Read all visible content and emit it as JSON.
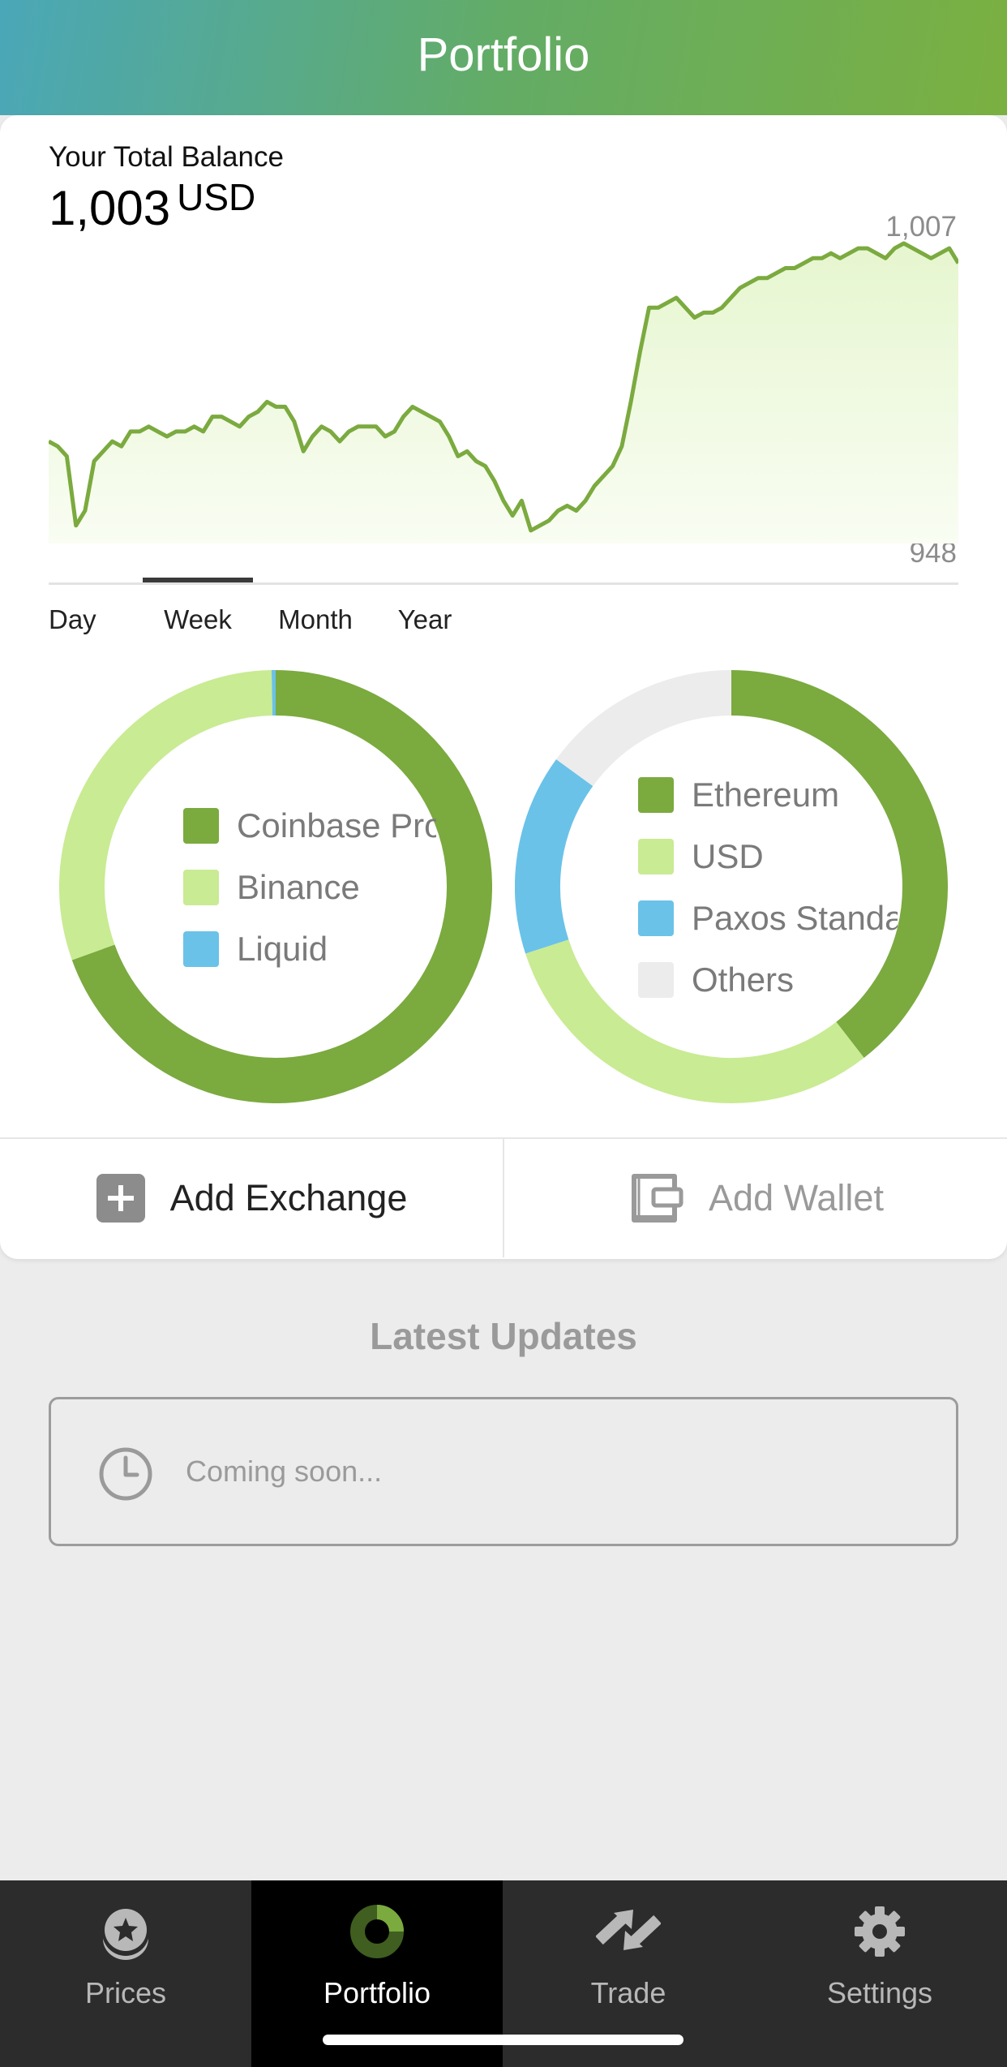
{
  "header": {
    "title": "Portfolio"
  },
  "balance": {
    "label": "Your Total Balance",
    "value": "1,003",
    "currency": "USD"
  },
  "colors": {
    "brand_green": "#7baa3f",
    "light_green": "#c9eb93",
    "blue": "#6ac2e8",
    "others_gray": "#ececec"
  },
  "balance_tabs": [
    {
      "label": "Day",
      "active": false
    },
    {
      "label": "Week",
      "active": true
    },
    {
      "label": "Month",
      "active": false
    },
    {
      "label": "Year",
      "active": false
    }
  ],
  "chart_data": [
    {
      "type": "area",
      "y_max_label": "1,007",
      "y_min_label": "948",
      "ylim": [
        948,
        1007
      ],
      "x": [
        0,
        1,
        2,
        3,
        4,
        5,
        6,
        7,
        8,
        9,
        10,
        11,
        12,
        13,
        14,
        15,
        16,
        17,
        18,
        19,
        20,
        21,
        22,
        23,
        24,
        25,
        26,
        27,
        28,
        29,
        30,
        31,
        32,
        33,
        34,
        35,
        36,
        37,
        38,
        39,
        40,
        41,
        42,
        43,
        44,
        45,
        46,
        47,
        48,
        49,
        50,
        51,
        52,
        53,
        54,
        55,
        56,
        57,
        58,
        59,
        60,
        61,
        62,
        63,
        64,
        65,
        66,
        67,
        68,
        69,
        70,
        71,
        72,
        73,
        74,
        75,
        76,
        77,
        78,
        79,
        80,
        81,
        82,
        83,
        84,
        85,
        86,
        87,
        88,
        89,
        90,
        91,
        92,
        93,
        94,
        95,
        96,
        97,
        98,
        99,
        100
      ],
      "values": [
        967,
        966,
        964,
        950,
        953,
        963,
        965,
        967,
        966,
        969,
        969,
        970,
        969,
        968,
        969,
        969,
        970,
        969,
        972,
        972,
        971,
        970,
        972,
        973,
        975,
        974,
        974,
        971,
        965,
        968,
        970,
        969,
        967,
        969,
        970,
        970,
        970,
        968,
        969,
        972,
        974,
        973,
        972,
        971,
        968,
        964,
        965,
        963,
        962,
        959,
        955,
        952,
        955,
        949,
        950,
        951,
        953,
        954,
        953,
        955,
        958,
        960,
        962,
        966,
        975,
        985,
        994,
        994,
        995,
        996,
        994,
        992,
        993,
        993,
        994,
        996,
        998,
        999,
        1000,
        1000,
        1001,
        1002,
        1002,
        1003,
        1004,
        1004,
        1005,
        1004,
        1005,
        1006,
        1006,
        1005,
        1004,
        1006,
        1007,
        1006,
        1005,
        1004,
        1005,
        1006,
        1003
      ],
      "fill_top_color": "#e6f6cf",
      "line_color": "#7baa3f"
    },
    {
      "type": "pie",
      "donut": true,
      "labels": [
        "Coinbase Pro",
        "Binance",
        "Liquid"
      ],
      "values": [
        69.5,
        30.2,
        0.3
      ],
      "colors": [
        "#7baa3f",
        "#c9eb93",
        "#6ac2e8"
      ]
    },
    {
      "type": "pie",
      "donut": true,
      "labels": [
        "Ethereum",
        "USD",
        "Paxos Standard",
        "Others"
      ],
      "values": [
        39.5,
        30.5,
        15.0,
        15.0
      ],
      "colors": [
        "#7baa3f",
        "#c9eb93",
        "#6ac2e8",
        "#ececec"
      ]
    }
  ],
  "actions": {
    "add_exchange": "Add Exchange",
    "add_wallet": "Add Wallet"
  },
  "updates": {
    "title": "Latest Updates",
    "placeholder": "Coming soon..."
  },
  "tabbar": [
    {
      "label": "Prices",
      "icon": "prices-icon",
      "active": false
    },
    {
      "label": "Portfolio",
      "icon": "portfolio-icon",
      "active": true
    },
    {
      "label": "Trade",
      "icon": "trade-icon",
      "active": false
    },
    {
      "label": "Settings",
      "icon": "gear-icon",
      "active": false
    }
  ]
}
